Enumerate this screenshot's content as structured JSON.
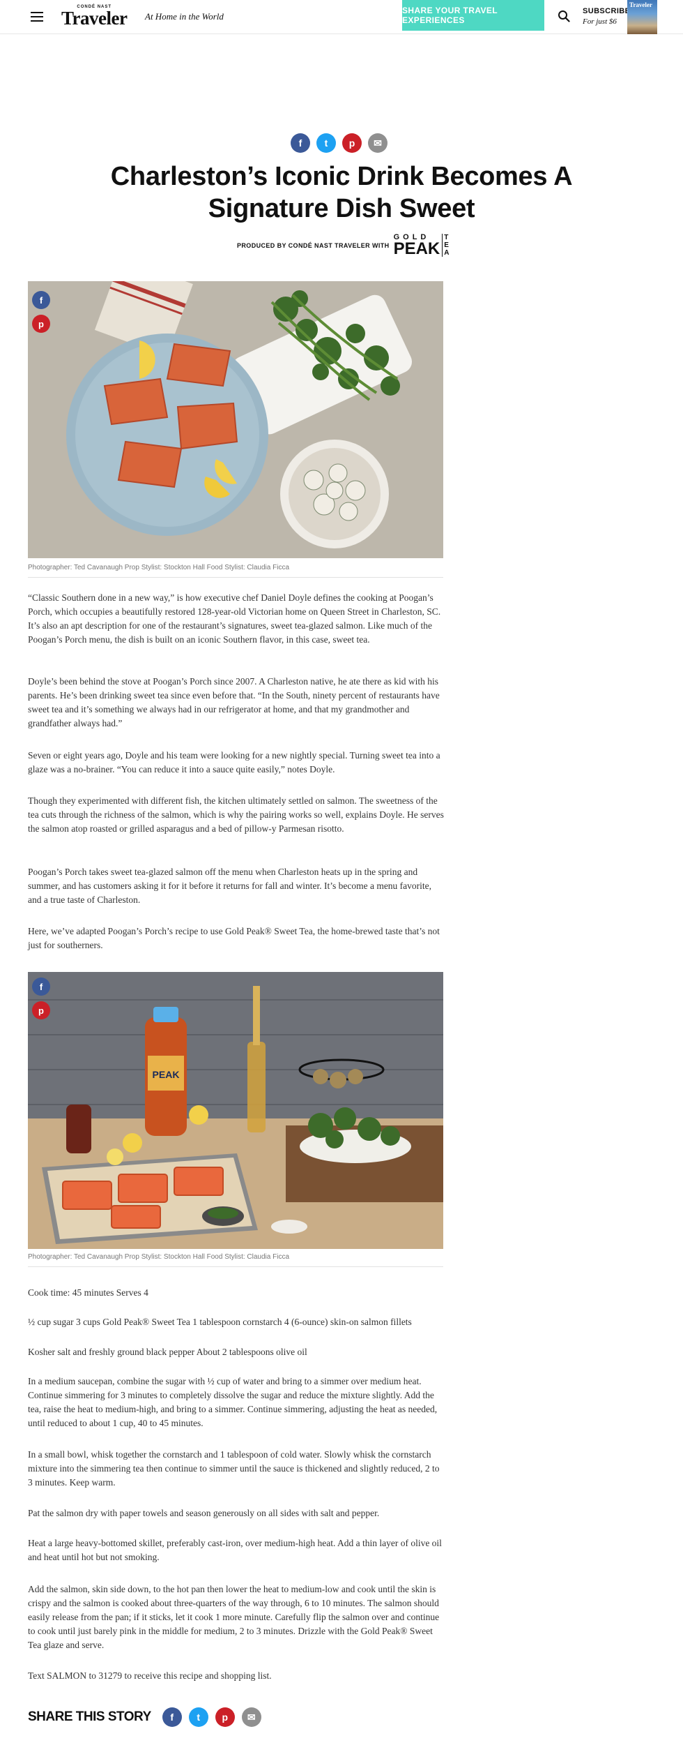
{
  "header": {
    "logo_top": "CONDÉ NAST",
    "logo_main": "Traveler",
    "tagline": "At Home in the World",
    "share_cta": "SHARE YOUR TRAVEL EXPERIENCES",
    "subscribe_title": "SUBSCRIBE",
    "subscribe_price": "For just $6",
    "magazine_title": "Traveler"
  },
  "share_icons": {
    "facebook": "f",
    "twitter": "t",
    "pinterest": "p",
    "email": "✉"
  },
  "article": {
    "title": "Charleston’s Iconic Drink Becomes A Signature Dish Sweet",
    "produced_by": "PRODUCED BY CONDÉ NAST TRAVELER WITH",
    "sponsor_gold": "GOLD",
    "sponsor_peak": "PEAK",
    "sponsor_tea": [
      "T",
      "E",
      "A"
    ],
    "caption1": "Photographer: Ted Cavanaugh Prop Stylist: Stockton Hall  Food Stylist: Claudia Ficca",
    "caption2": "Photographer: Ted Cavanaugh Prop Stylist: Stockton Hall  Food Stylist: Claudia Ficca",
    "paragraphs": [
      "“Classic Southern done in a new way,” is how executive chef Daniel Doyle defines the cooking at Poogan’s Porch, which occupies a beautifully restored 128-year-old Victorian home on Queen Street in Charleston, SC. It’s also an apt description for one of the restaurant’s signatures, sweet tea-glazed salmon. Like much of the Poogan’s Porch menu, the dish is built on an iconic Southern flavor, in this case, sweet tea.",
      "Doyle’s been behind the stove at Poogan’s Porch since 2007. A Charleston native, he ate there as kid with his parents. He’s been drinking sweet tea since even before that. “In the South, ninety percent of restaurants have sweet tea and it’s something we always had in our refrigerator at home, and that my grandmother and grandfather always had.”",
      "Seven or eight years ago, Doyle and his team were looking for a new nightly special. Turning sweet tea into a glaze was a no-brainer. “You can reduce it into a sauce quite easily,” notes Doyle.",
      "Though they experimented with different fish, the kitchen ultimately settled on salmon. The sweetness of the tea cuts through the richness of the salmon, which is why the pairing works so well, explains Doyle. He serves the salmon atop roasted or grilled asparagus and a bed of pillow-y Parmesan risotto.",
      "Poogan’s Porch takes sweet tea-glazed salmon off the menu when Charleston heats up in the spring and summer, and has customers asking it for it before it returns for fall and winter. It’s become a menu favorite, and a true taste of Charleston.",
      "Here, we’ve adapted Poogan’s Porch’s recipe to use Gold Peak® Sweet Tea, the home-brewed taste that’s not just for southerners."
    ],
    "recipe": [
      "Cook time: 45 minutes Serves 4",
      "½ cup sugar 3 cups Gold Peak® Sweet Tea 1 tablespoon cornstarch 4 (6-ounce) skin-on salmon fillets",
      "Kosher salt and freshly ground black pepper About 2 tablespoons olive oil",
      "In a medium saucepan, combine the sugar with ½ cup of water and bring to a simmer over medium heat. Continue simmering for 3 minutes to completely dissolve the sugar and reduce the mixture slightly. Add the tea, raise the heat to medium-high, and bring to a simmer. Continue simmering, adjusting the heat as needed, until reduced to about 1 cup, 40 to 45 minutes.",
      "In a small bowl, whisk together the cornstarch and 1 tablespoon of cold water. Slowly whisk the cornstarch mixture into the simmering tea then continue to simmer until the sauce is thickened and slightly reduced, 2 to 3 minutes. Keep warm.",
      "Pat the salmon dry with paper towels and season generously on all sides with salt and pepper.",
      "Heat a large heavy-bottomed skillet, preferably cast-iron, over medium-high heat. Add a thin layer of olive oil and heat until hot but not smoking.",
      "Add the salmon, skin side down, to the hot pan then lower the heat to medium-low and cook until the skin is crispy and the salmon is cooked about three-quarters of the way through, 6 to 10 minutes. The salmon should easily release from the pan; if it sticks, let it cook 1 more minute. Carefully flip the salmon over and continue to cook until just barely pink in the middle for medium, 2 to 3 minutes. Drizzle with the Gold Peak® Sweet Tea glaze and serve.",
      "Text SALMON to 31279 to receive this recipe and shopping list."
    ],
    "bottle_label": "PEAK",
    "share_story_label": "SHARE THIS STORY"
  }
}
